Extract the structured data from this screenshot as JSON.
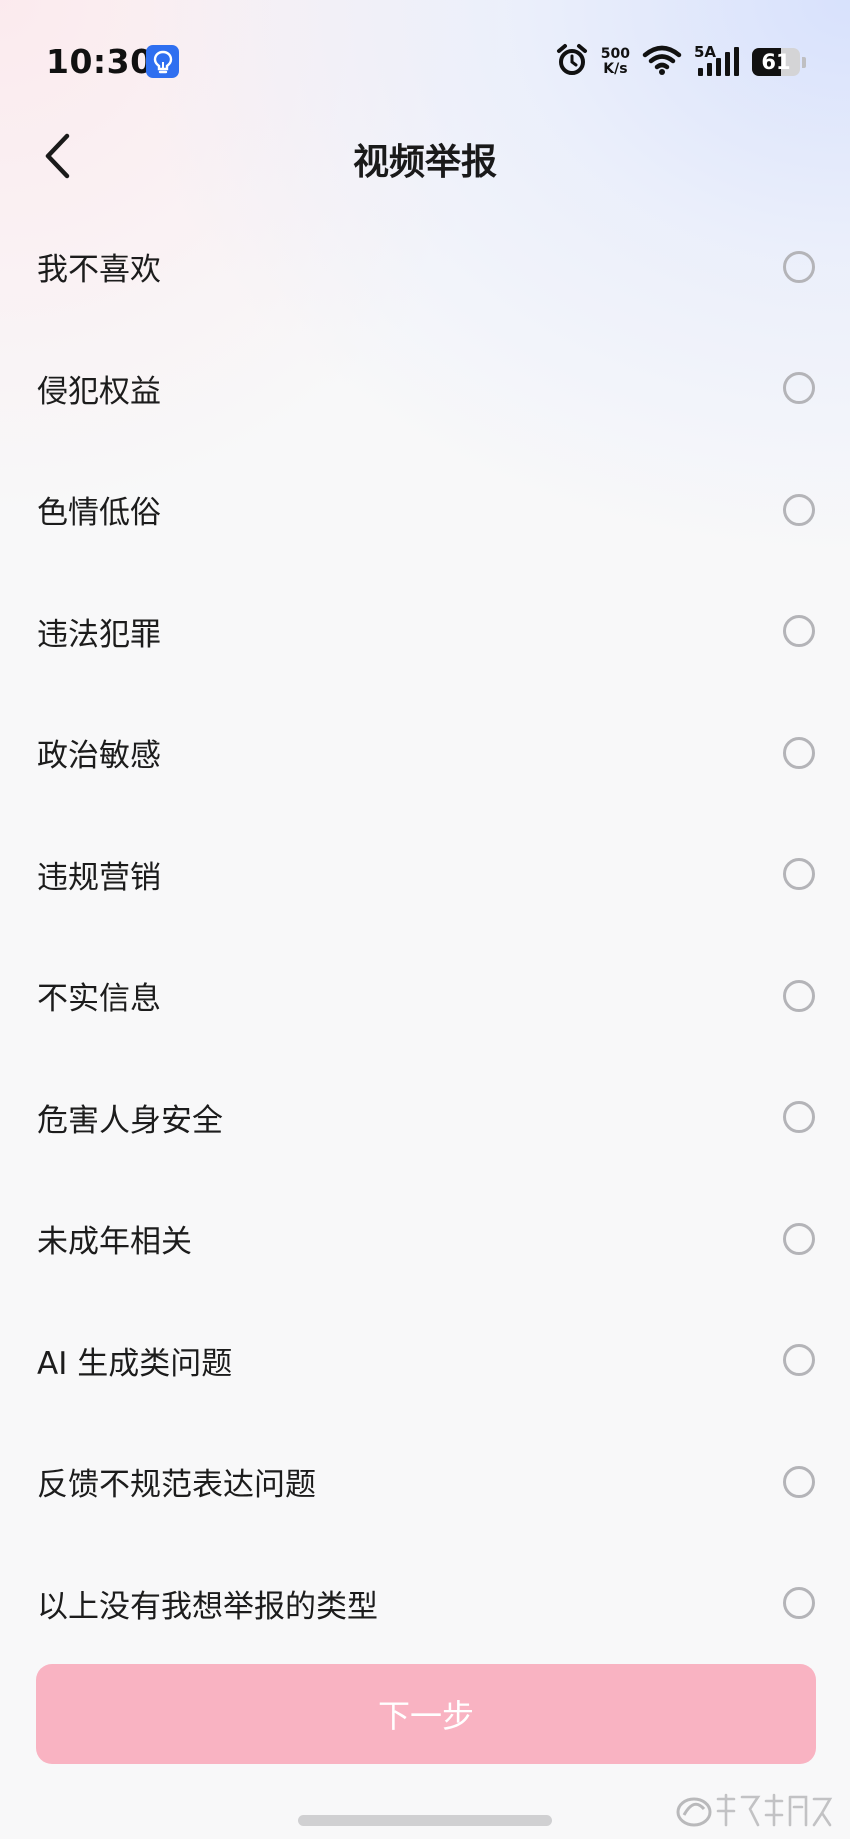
{
  "status_bar": {
    "time": "10:30",
    "net_speed_value": "500",
    "net_speed_unit": "K/s",
    "signal_label": "5A",
    "battery_level": "61"
  },
  "header": {
    "title": "视频举报"
  },
  "options": [
    {
      "label": "我不喜欢"
    },
    {
      "label": "侵犯权益"
    },
    {
      "label": "色情低俗"
    },
    {
      "label": "违法犯罪"
    },
    {
      "label": "政治敏感"
    },
    {
      "label": "违规营销"
    },
    {
      "label": "不实信息"
    },
    {
      "label": "危害人身安全"
    },
    {
      "label": "未成年相关"
    },
    {
      "label": "AI 生成类问题"
    },
    {
      "label": "反馈不规范表达问题"
    },
    {
      "label": "以上没有我想举报的类型"
    }
  ],
  "next_button": {
    "label": "下一步",
    "state": "disabled"
  },
  "watermark_text": "华声新闻网",
  "colors": {
    "accent_disabled": "#f9b3c2",
    "radio_border": "#b4b4b8",
    "text_primary": "#1c1c1c"
  }
}
